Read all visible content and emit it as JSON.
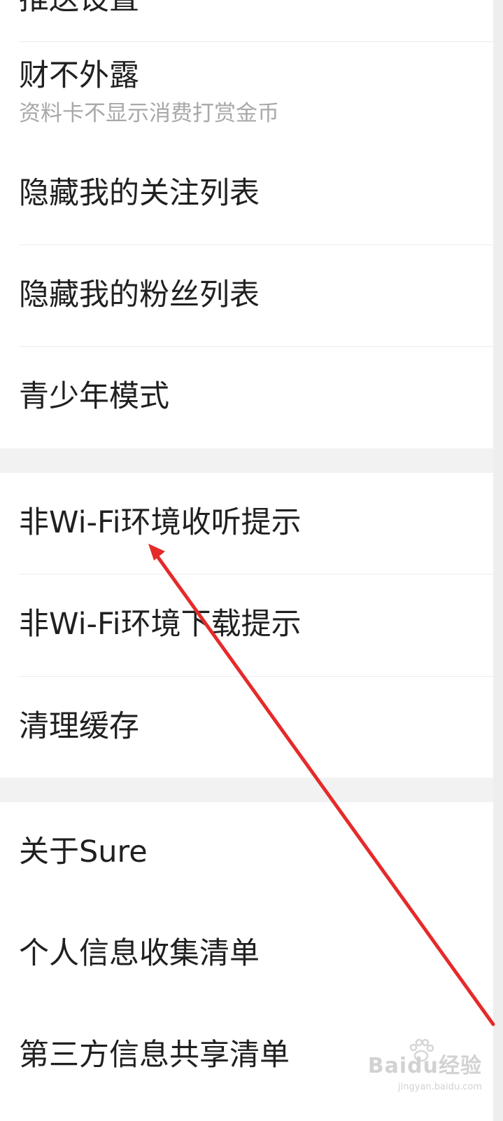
{
  "settings": {
    "items": [
      {
        "label": "推送设置"
      },
      {
        "label": "财不外露",
        "subtitle": "资料卡不显示消费打赏金币"
      },
      {
        "label": "隐藏我的关注列表"
      },
      {
        "label": "隐藏我的粉丝列表"
      },
      {
        "label": "青少年模式"
      },
      {
        "label": "非Wi-Fi环境收听提示"
      },
      {
        "label": "非Wi-Fi环境下载提示"
      },
      {
        "label": "清理缓存"
      },
      {
        "label": "关于Sure"
      },
      {
        "label": "个人信息收集清单"
      },
      {
        "label": "第三方信息共享清单"
      }
    ]
  },
  "annotation": {
    "arrow_color": "#e52a2a"
  },
  "watermark": {
    "brand": "Baidu经验",
    "url": "jingyan.baidu.com"
  },
  "colors": {
    "background": "#f2f2f2",
    "card": "#ffffff",
    "text_primary": "#202020",
    "text_secondary": "#a8a8a8"
  }
}
